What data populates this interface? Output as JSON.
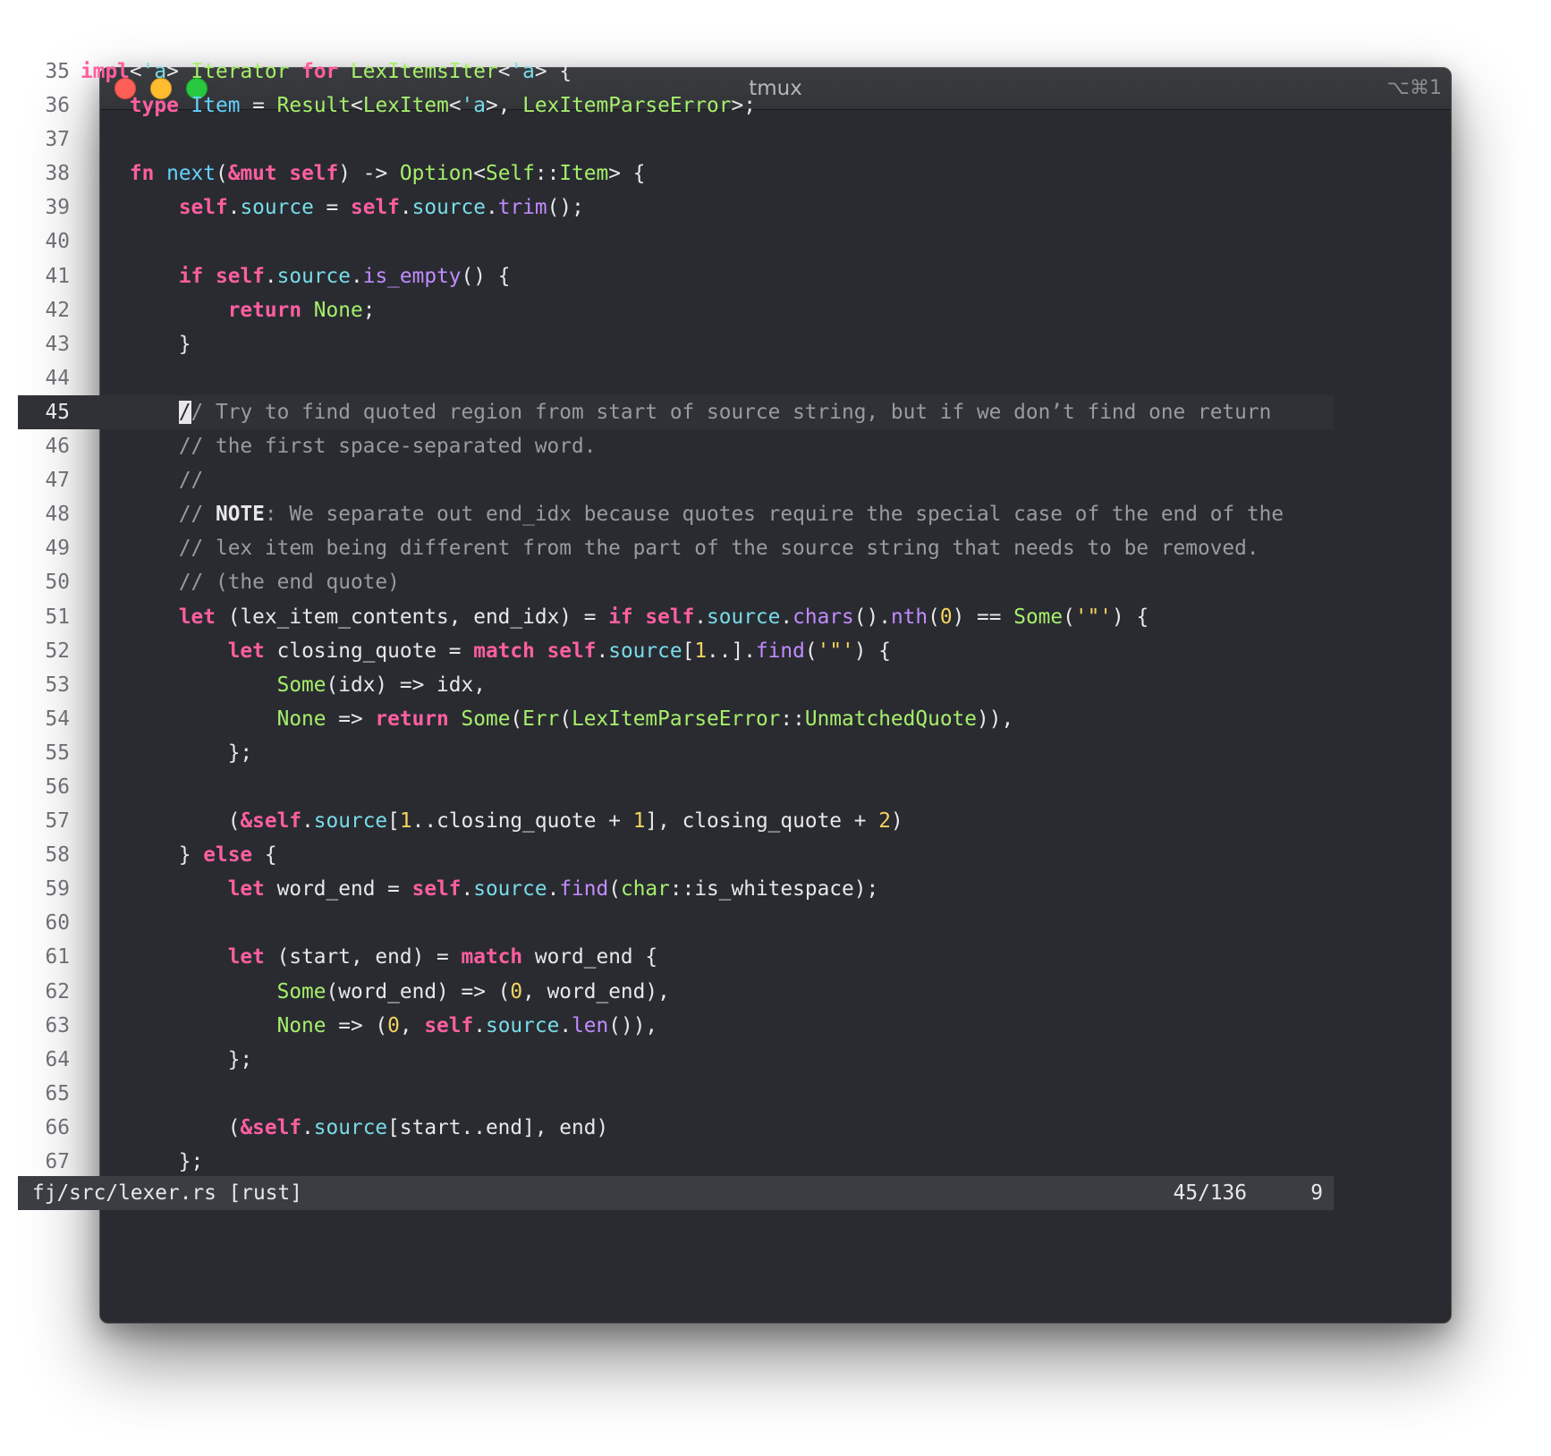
{
  "window": {
    "title": "tmux",
    "shortcut": "⌥⌘1"
  },
  "editor": {
    "current_line": 45,
    "lines": [
      {
        "n": "35",
        "tokens": [
          [
            "kw",
            "impl"
          ],
          [
            "pl",
            "<"
          ],
          [
            "at",
            "'a"
          ],
          [
            "pl",
            "> "
          ],
          [
            "ty",
            "Iterator"
          ],
          [
            "pl",
            " "
          ],
          [
            "kw",
            "for"
          ],
          [
            "pl",
            " "
          ],
          [
            "ty",
            "LexItemsIter"
          ],
          [
            "pl",
            "<"
          ],
          [
            "at",
            "'a"
          ],
          [
            "pl",
            "> {"
          ]
        ]
      },
      {
        "n": "36",
        "tokens": [
          [
            "pl",
            "    "
          ],
          [
            "kw",
            "type"
          ],
          [
            "pl",
            " "
          ],
          [
            "fn",
            "Item"
          ],
          [
            "pl",
            " = "
          ],
          [
            "ty",
            "Result"
          ],
          [
            "pl",
            "<"
          ],
          [
            "ty",
            "LexItem"
          ],
          [
            "pl",
            "<"
          ],
          [
            "at",
            "'a"
          ],
          [
            "pl",
            ">, "
          ],
          [
            "ty",
            "LexItemParseError"
          ],
          [
            "pl",
            ">;"
          ]
        ]
      },
      {
        "n": "37",
        "tokens": []
      },
      {
        "n": "38",
        "tokens": [
          [
            "pl",
            "    "
          ],
          [
            "kw",
            "fn"
          ],
          [
            "pl",
            " "
          ],
          [
            "fn",
            "next"
          ],
          [
            "pl",
            "("
          ],
          [
            "kw",
            "&mut self"
          ],
          [
            "pl",
            ") -> "
          ],
          [
            "ty",
            "Option"
          ],
          [
            "pl",
            "<"
          ],
          [
            "ty",
            "Self"
          ],
          [
            "pl",
            "::"
          ],
          [
            "ty",
            "Item"
          ],
          [
            "pl",
            "> {"
          ]
        ]
      },
      {
        "n": "39",
        "tokens": [
          [
            "pl",
            "        "
          ],
          [
            "kw",
            "self"
          ],
          [
            "pl",
            "."
          ],
          [
            "at",
            "source"
          ],
          [
            "pl",
            " = "
          ],
          [
            "kw",
            "self"
          ],
          [
            "pl",
            "."
          ],
          [
            "at",
            "source"
          ],
          [
            "pl",
            "."
          ],
          [
            "mt",
            "trim"
          ],
          [
            "pl",
            "();"
          ]
        ]
      },
      {
        "n": "40",
        "tokens": []
      },
      {
        "n": "41",
        "tokens": [
          [
            "pl",
            "        "
          ],
          [
            "kw",
            "if"
          ],
          [
            "pl",
            " "
          ],
          [
            "kw",
            "self"
          ],
          [
            "pl",
            "."
          ],
          [
            "at",
            "source"
          ],
          [
            "pl",
            "."
          ],
          [
            "mt",
            "is_empty"
          ],
          [
            "pl",
            "() {"
          ]
        ]
      },
      {
        "n": "42",
        "tokens": [
          [
            "pl",
            "            "
          ],
          [
            "kw",
            "return"
          ],
          [
            "pl",
            " "
          ],
          [
            "ty",
            "None"
          ],
          [
            "pl",
            ";"
          ]
        ]
      },
      {
        "n": "43",
        "tokens": [
          [
            "pl",
            "        }"
          ]
        ]
      },
      {
        "n": "44",
        "tokens": []
      },
      {
        "n": "45",
        "tokens": [
          [
            "pl",
            "        "
          ],
          [
            "cursor",
            "/"
          ],
          [
            "cm",
            "/ Try to find quoted region from start of source string, but if we don’t find one return"
          ]
        ]
      },
      {
        "n": "46",
        "tokens": [
          [
            "pl",
            "        "
          ],
          [
            "cm",
            "// the first space-separated word."
          ]
        ]
      },
      {
        "n": "47",
        "tokens": [
          [
            "pl",
            "        "
          ],
          [
            "cm",
            "//"
          ]
        ]
      },
      {
        "n": "48",
        "tokens": [
          [
            "pl",
            "        "
          ],
          [
            "cm",
            "// "
          ],
          [
            "cmb",
            "NOTE"
          ],
          [
            "cm",
            ": We separate out end_idx because quotes require the special case of the end of the"
          ]
        ]
      },
      {
        "n": "49",
        "tokens": [
          [
            "pl",
            "        "
          ],
          [
            "cm",
            "// lex item being different from the part of the source string that needs to be removed."
          ]
        ]
      },
      {
        "n": "50",
        "tokens": [
          [
            "pl",
            "        "
          ],
          [
            "cm",
            "// (the end quote)"
          ]
        ]
      },
      {
        "n": "51",
        "tokens": [
          [
            "pl",
            "        "
          ],
          [
            "kw",
            "let"
          ],
          [
            "pl",
            " (lex_item_contents, end_idx) = "
          ],
          [
            "kw",
            "if"
          ],
          [
            "pl",
            " "
          ],
          [
            "kw",
            "self"
          ],
          [
            "pl",
            "."
          ],
          [
            "at",
            "source"
          ],
          [
            "pl",
            "."
          ],
          [
            "mt",
            "chars"
          ],
          [
            "pl",
            "()."
          ],
          [
            "mt",
            "nth"
          ],
          [
            "pl",
            "("
          ],
          [
            "nm",
            "0"
          ],
          [
            "pl",
            ") == "
          ],
          [
            "ty",
            "Some"
          ],
          [
            "pl",
            "("
          ],
          [
            "nm",
            "'\"'"
          ],
          [
            "pl",
            ") {"
          ]
        ]
      },
      {
        "n": "52",
        "tokens": [
          [
            "pl",
            "            "
          ],
          [
            "kw",
            "let"
          ],
          [
            "pl",
            " closing_quote = "
          ],
          [
            "kw",
            "match"
          ],
          [
            "pl",
            " "
          ],
          [
            "kw",
            "self"
          ],
          [
            "pl",
            "."
          ],
          [
            "at",
            "source"
          ],
          [
            "pl",
            "["
          ],
          [
            "nm",
            "1"
          ],
          [
            "pl",
            "..]."
          ],
          [
            "mt",
            "find"
          ],
          [
            "pl",
            "("
          ],
          [
            "nm",
            "'\"'"
          ],
          [
            "pl",
            ") {"
          ]
        ]
      },
      {
        "n": "53",
        "tokens": [
          [
            "pl",
            "                "
          ],
          [
            "ty",
            "Some"
          ],
          [
            "pl",
            "(idx) => idx,"
          ]
        ]
      },
      {
        "n": "54",
        "tokens": [
          [
            "pl",
            "                "
          ],
          [
            "ty",
            "None"
          ],
          [
            "pl",
            " => "
          ],
          [
            "kw",
            "return"
          ],
          [
            "pl",
            " "
          ],
          [
            "ty",
            "Some"
          ],
          [
            "pl",
            "("
          ],
          [
            "ty",
            "Err"
          ],
          [
            "pl",
            "("
          ],
          [
            "ty",
            "LexItemParseError"
          ],
          [
            "pl",
            "::"
          ],
          [
            "ty",
            "UnmatchedQuote"
          ],
          [
            "pl",
            ")),"
          ]
        ]
      },
      {
        "n": "55",
        "tokens": [
          [
            "pl",
            "            };"
          ]
        ]
      },
      {
        "n": "56",
        "tokens": []
      },
      {
        "n": "57",
        "tokens": [
          [
            "pl",
            "            ("
          ],
          [
            "kw",
            "&self"
          ],
          [
            "pl",
            "."
          ],
          [
            "at",
            "source"
          ],
          [
            "pl",
            "["
          ],
          [
            "nm",
            "1"
          ],
          [
            "pl",
            "..closing_quote + "
          ],
          [
            "nm",
            "1"
          ],
          [
            "pl",
            "], closing_quote + "
          ],
          [
            "nm",
            "2"
          ],
          [
            "pl",
            ")"
          ]
        ]
      },
      {
        "n": "58",
        "tokens": [
          [
            "pl",
            "        } "
          ],
          [
            "kw",
            "else"
          ],
          [
            "pl",
            " {"
          ]
        ]
      },
      {
        "n": "59",
        "tokens": [
          [
            "pl",
            "            "
          ],
          [
            "kw",
            "let"
          ],
          [
            "pl",
            " word_end = "
          ],
          [
            "kw",
            "self"
          ],
          [
            "pl",
            "."
          ],
          [
            "at",
            "source"
          ],
          [
            "pl",
            "."
          ],
          [
            "mt",
            "find"
          ],
          [
            "pl",
            "("
          ],
          [
            "ty",
            "char"
          ],
          [
            "pl",
            "::is_whitespace);"
          ]
        ]
      },
      {
        "n": "60",
        "tokens": []
      },
      {
        "n": "61",
        "tokens": [
          [
            "pl",
            "            "
          ],
          [
            "kw",
            "let"
          ],
          [
            "pl",
            " (start, end) = "
          ],
          [
            "kw",
            "match"
          ],
          [
            "pl",
            " word_end {"
          ]
        ]
      },
      {
        "n": "62",
        "tokens": [
          [
            "pl",
            "                "
          ],
          [
            "ty",
            "Some"
          ],
          [
            "pl",
            "(word_end) => ("
          ],
          [
            "nm",
            "0"
          ],
          [
            "pl",
            ", word_end),"
          ]
        ]
      },
      {
        "n": "63",
        "tokens": [
          [
            "pl",
            "                "
          ],
          [
            "ty",
            "None"
          ],
          [
            "pl",
            " => ("
          ],
          [
            "nm",
            "0"
          ],
          [
            "pl",
            ", "
          ],
          [
            "kw",
            "self"
          ],
          [
            "pl",
            "."
          ],
          [
            "at",
            "source"
          ],
          [
            "pl",
            "."
          ],
          [
            "mt",
            "len"
          ],
          [
            "pl",
            "()),"
          ]
        ]
      },
      {
        "n": "64",
        "tokens": [
          [
            "pl",
            "            };"
          ]
        ]
      },
      {
        "n": "65",
        "tokens": []
      },
      {
        "n": "66",
        "tokens": [
          [
            "pl",
            "            ("
          ],
          [
            "kw",
            "&self"
          ],
          [
            "pl",
            "."
          ],
          [
            "at",
            "source"
          ],
          [
            "pl",
            "[start..end], end)"
          ]
        ]
      },
      {
        "n": "67",
        "tokens": [
          [
            "pl",
            "        };"
          ]
        ]
      }
    ]
  },
  "statusbar": {
    "file": "fj/src/lexer.rs [rust]",
    "position": "45/136",
    "column": "9"
  },
  "colors": {
    "background": "#292b31",
    "keyword": "#ff5f9e",
    "type": "#a6ef6a",
    "function": "#64d2ff",
    "method": "#c28bff",
    "number": "#f5d45e",
    "comment": "#9a9ba0"
  }
}
